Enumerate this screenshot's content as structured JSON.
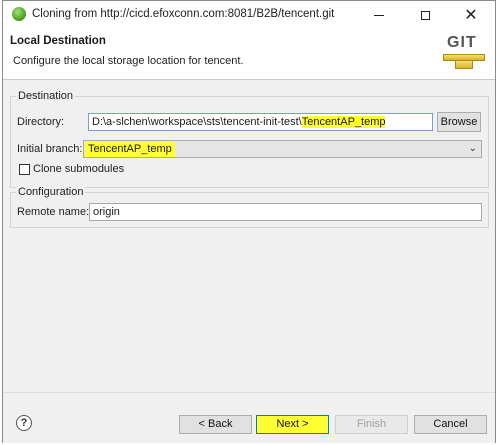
{
  "window": {
    "title": "Cloning from http://cicd.efoxconn.com:8081/B2B/tencent.git",
    "close_glyph": "✕"
  },
  "banner": {
    "title": "Local Destination",
    "description": "Configure the local storage location for tencent.",
    "logo_text": "GIT"
  },
  "destination": {
    "group_label": "Destination",
    "directory_label": "Directory:",
    "directory_prefix": "D:\\a-slchen\\workspace\\sts\\tencent-init-test\\",
    "directory_highlight": "TencentAP_temp",
    "browse_label": "Browse",
    "initial_branch_label": "Initial branch:",
    "initial_branch_value": "TencentAP_temp",
    "clone_submodules_label": "Clone submodules",
    "clone_submodules_checked": false
  },
  "configuration": {
    "group_label": "Configuration",
    "remote_name_label": "Remote name:",
    "remote_name_value": "origin"
  },
  "footer": {
    "help_glyph": "?",
    "back_label": "< Back",
    "next_label": "Next >",
    "finish_label": "Finish",
    "cancel_label": "Cancel"
  },
  "colors": {
    "highlight": "#ffff33",
    "accent_border": "#0078d7"
  },
  "icons": {
    "app": "eclipse-sts-icon",
    "chevron": "chevron-down-icon"
  }
}
